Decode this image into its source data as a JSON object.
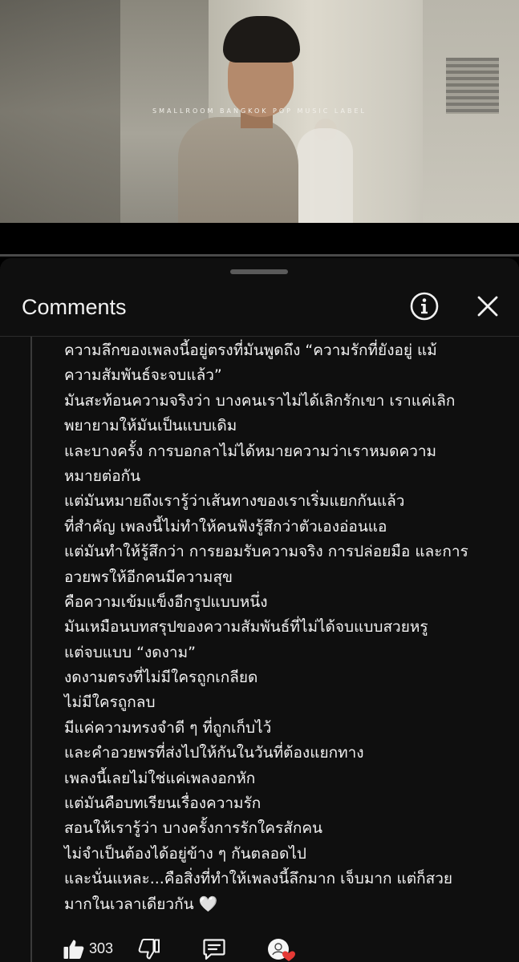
{
  "video": {
    "watermark": "SMALLROOM   BANGKOK POP MUSIC LABEL"
  },
  "comments_panel": {
    "title": "Comments",
    "info_icon": "info-icon",
    "close_icon": "close-icon"
  },
  "comment": {
    "lines": [
      "ความลึกของเพลงนี้อยู่ตรงที่มันพูดถึง “ความรักที่ยังอยู่ แม้",
      "ความสัมพันธ์จะจบแล้ว”",
      "มันสะท้อนความจริงว่า บางคนเราไม่ได้เลิกรักเขา เราแค่เลิก",
      "พยายามให้มันเป็นแบบเดิม",
      "และบางครั้ง การบอกลาไม่ได้หมายความว่าเราหมดความ",
      "หมายต่อกัน",
      "แต่มันหมายถึงเรารู้ว่าเส้นทางของเราเริ่มแยกกันแล้ว",
      "ที่สำคัญ เพลงนี้ไม่ทำให้คนฟังรู้สึกว่าตัวเองอ่อนแอ",
      "แต่มันทำให้รู้สึกว่า การยอมรับความจริง การปล่อยมือ และการ",
      "อวยพรให้อีกคนมีความสุข",
      "คือความเข้มแข็งอีกรูปแบบหนึ่ง",
      "มันเหมือนบทสรุปของความสัมพันธ์ที่ไม่ได้จบแบบสวยหรู",
      "แต่จบแบบ “งดงาม”",
      "งดงามตรงที่ไม่มีใครถูกเกลียด",
      "ไม่มีใครถูกลบ",
      "มีแค่ความทรงจำดี ๆ ที่ถูกเก็บไว้",
      "และคำอวยพรที่ส่งไปให้กันในวันที่ต้องแยกทาง",
      "เพลงนี้เลยไม่ใช่แค่เพลงอกหัก",
      "แต่มันคือบทเรียนเรื่องความรัก",
      "สอนให้เรารู้ว่า บางครั้งการรักใครสักคน",
      "ไม่จำเป็นต้องได้อยู่ข้าง ๆ กันตลอดไป",
      "และนั่นแหละ...คือสิ่งที่ทำให้เพลงนี้ลึกมาก เจ็บมาก แต่ก็สวย",
      "มากในเวลาเดียวกัน 🤍"
    ],
    "like_count": "303",
    "like_icon": "thumbs-up-icon",
    "dislike_icon": "thumbs-down-icon",
    "reply_icon": "reply-icon",
    "creator_heart_icon": "creator-heart-icon"
  }
}
